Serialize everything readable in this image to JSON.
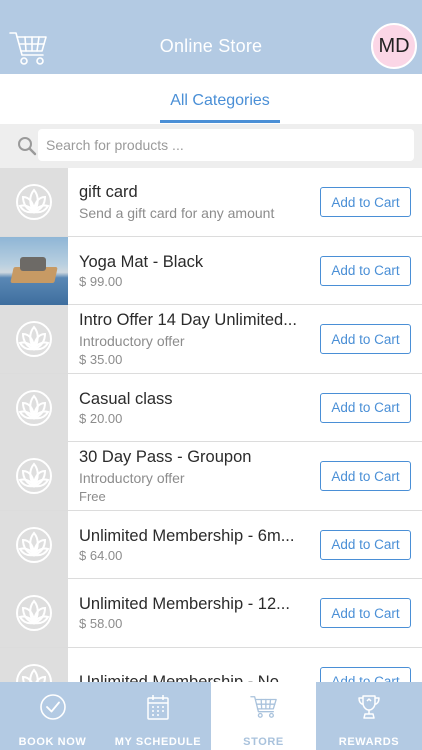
{
  "header": {
    "title": "Online Store",
    "cart_icon": "cart-icon",
    "avatar_initials": "MD"
  },
  "tabs": [
    {
      "label": "All Categories",
      "active": true
    }
  ],
  "search": {
    "placeholder": "Search for products ...",
    "value": ""
  },
  "products": [
    {
      "name": "gift card",
      "subtitle": "Send a gift card for any amount",
      "price": "",
      "thumb": "lotus-icon",
      "button": "Add to Cart"
    },
    {
      "name": "Yoga Mat - Black",
      "subtitle": "",
      "price": "$ 99.00",
      "thumb": "photo",
      "button": "Add to Cart"
    },
    {
      "name": "Intro Offer 14 Day Unlimited...",
      "subtitle": "Introductory offer",
      "price": "$ 35.00",
      "thumb": "lotus-icon",
      "button": "Add to Cart"
    },
    {
      "name": "Casual class",
      "subtitle": "",
      "price": "$ 20.00",
      "thumb": "lotus-icon",
      "button": "Add to Cart"
    },
    {
      "name": "30 Day Pass - Groupon",
      "subtitle": "Introductory offer",
      "price": "Free",
      "thumb": "lotus-icon",
      "button": "Add to Cart"
    },
    {
      "name": "Unlimited Membership - 6m...",
      "subtitle": "",
      "price": "$ 64.00",
      "thumb": "lotus-icon",
      "button": "Add to Cart"
    },
    {
      "name": "Unlimited Membership - 12...",
      "subtitle": "",
      "price": "$ 58.00",
      "thumb": "lotus-icon",
      "button": "Add to Cart"
    },
    {
      "name": "Unlimited Membership - No ...",
      "subtitle": "",
      "price": "",
      "thumb": "lotus-icon",
      "button": "Add to Cart"
    }
  ],
  "bottom_nav": [
    {
      "label": "BOOK NOW",
      "icon": "check-circle-icon",
      "active": false
    },
    {
      "label": "MY SCHEDULE",
      "icon": "calendar-icon",
      "active": false
    },
    {
      "label": "STORE",
      "icon": "cart-icon",
      "active": true
    },
    {
      "label": "REWARDS",
      "icon": "trophy-icon",
      "active": false
    }
  ],
  "colors": {
    "header_bg": "#b3cae3",
    "accent": "#4a8fd6",
    "avatar_bg": "#fbd6e6"
  }
}
